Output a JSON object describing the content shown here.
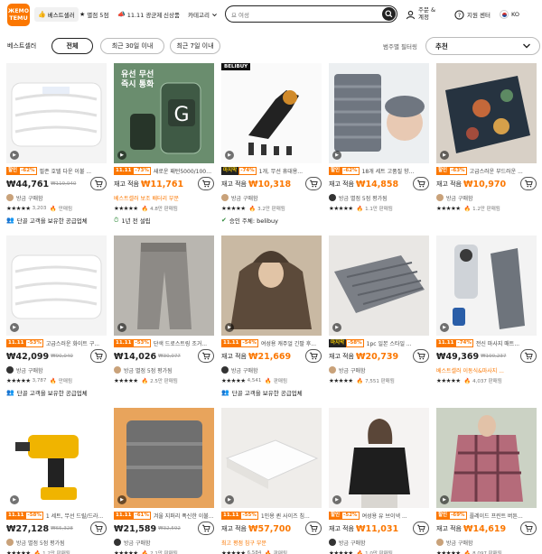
{
  "brand": {
    "logo_top": "ЖЕМО",
    "logo_bottom": "TEMU",
    "color": "#fb7701"
  },
  "nav": {
    "bestseller": "베스트셀러",
    "five_star": "별점 5점",
    "sale": "11.11 광군제",
    "new": "신상품",
    "category": "카테고리"
  },
  "search": {
    "value": "요 여성"
  },
  "header": {
    "orders": "주문 & 계정",
    "support": "지원 센터",
    "lang": "KO"
  },
  "filters": {
    "page_title": "베스트셀러",
    "chips": [
      "전체",
      "최근 30일 이내",
      "최근 7일 이내"
    ],
    "sort_label": "범주별 필터링",
    "sort_value": "추천"
  },
  "products": [
    {
      "tag1": "할인",
      "tag2": "-62%",
      "title": "필존 호텔 다운 이불 ...",
      "stock": "",
      "price": "₩44,761",
      "old": "₩119,940",
      "sold": "",
      "seller_icon": "user",
      "seller": "방금 구매함",
      "stars": "★★★★★",
      "rcount": "3,203",
      "hot": "만매됨",
      "extra": "단골 고객을 보유한 공급업체",
      "extra_icon": "👥"
    },
    {
      "tag1": "11.11",
      "tag2": "-73%",
      "title": "새로운 패턴5000/1000...",
      "stock": "재고 적음",
      "price": "₩11,761",
      "old": "",
      "sold": "",
      "seller_icon": "",
      "seller": "베스트셀러 보조 배터리 부문",
      "stars": "★★★★★",
      "rcount": "",
      "hot": "4.8만 판매됨",
      "extra": "1년 전 설립",
      "extra_icon": "⏱"
    },
    {
      "tag1": "마지막",
      "tag2": "-74%",
      "title": "1개, 무선 휴대용...",
      "stock": "재고 적음",
      "price": "₩10,318",
      "old": "",
      "sold": "",
      "seller_icon": "user",
      "seller": "방금 구매함",
      "stars": "★★★★★",
      "rcount": "",
      "hot": "3.2만 판매됨",
      "extra": "승인 주체: belibuy",
      "extra_icon": "✔"
    },
    {
      "tag1": "할인",
      "tag2": "-62%",
      "title": "18개 세트 고품질 향...",
      "stock": "재고 적음",
      "price": "₩14,858",
      "old": "",
      "sold": "",
      "seller_icon": "user",
      "seller": "방금 별점 5점 평가됨",
      "stars": "★★★★★",
      "rcount": "",
      "hot": "1.1만 판매됨",
      "extra": "",
      "extra_icon": ""
    },
    {
      "tag1": "할인",
      "tag2": "-63%",
      "title": "고급스러운 부드러운 ...",
      "stock": "재고 적음",
      "price": "₩10,970",
      "old": "",
      "sold": "",
      "seller_icon": "user",
      "seller": "방금 구매함",
      "stars": "★★★★★",
      "rcount": "",
      "hot": "1.2만 판매됨",
      "extra": "",
      "extra_icon": ""
    },
    {
      "tag1": "11.11",
      "tag2": "-53%",
      "title": "고급스러운 화이트 구...",
      "stock": "",
      "price": "₩42,099",
      "old": "₩90,040",
      "sold": "",
      "seller_icon": "user",
      "seller": "방금 구매함",
      "stars": "★★★★★",
      "rcount": "3,787",
      "hot": "만매됨",
      "extra": "단골 고객을 보유한 공급업체",
      "extra_icon": "👥"
    },
    {
      "tag1": "11.11",
      "tag2": "-53%",
      "title": "단색 드로스트링 조거...",
      "stock": "",
      "price": "₩14,026",
      "old": "₩30,077",
      "sold": "",
      "seller_icon": "user",
      "seller": "방금 별점 5점 평가됨",
      "stars": "★★★★★",
      "rcount": "",
      "hot": "2.5만 판매됨",
      "extra": "",
      "extra_icon": ""
    },
    {
      "tag1": "11.11",
      "tag2": "-54%",
      "title": "여성용 캐주얼 긴팔 후...",
      "stock": "재고 적음",
      "price": "₩21,669",
      "old": "",
      "sold": "",
      "seller_icon": "user",
      "seller": "방금 구매함",
      "stars": "★★★★★",
      "rcount": "4,541",
      "hot": "판매됨",
      "extra": "단골 고객을 보유한 공급업체",
      "extra_icon": "👥"
    },
    {
      "tag1": "마지막",
      "tag2": "-58%",
      "title": "1pc 일본 스타일 ...",
      "stock": "재고 적음",
      "price": "₩20,739",
      "old": "",
      "sold": "",
      "seller_icon": "user",
      "seller": "방금 구매함",
      "stars": "★★★★★",
      "rcount": "",
      "hot": "7,551 판매됨",
      "extra": "",
      "extra_icon": ""
    },
    {
      "tag1": "11.11",
      "tag2": "-74%",
      "title": "전신 마사지 매트...",
      "stock": "",
      "price": "₩49,369",
      "old": "₩190,237",
      "sold": "",
      "seller_icon": "",
      "seller": "베스트셀러 이동식&마사지 ...",
      "stars": "★★★★★",
      "rcount": "",
      "hot": "4,037 판매됨",
      "extra": "",
      "extra_icon": ""
    },
    {
      "tag1": "11.11",
      "tag2": "-58%",
      "title": "1 세트, 무선 드릴/드라...",
      "stock": "",
      "price": "₩27,128",
      "old": "₩65,328",
      "sold": "",
      "seller_icon": "user",
      "seller": "방금 별점 5점 평가됨",
      "stars": "★★★★★",
      "rcount": "",
      "hot": "1.2만 판매됨",
      "extra": "",
      "extra_icon": ""
    },
    {
      "tag1": "11.11",
      "tag2": "-61%",
      "title": "겨울 지퍼리 폭신한 이불...",
      "stock": "",
      "price": "₩21,589",
      "old": "₩32,592",
      "sold": "",
      "seller_icon": "user",
      "seller": "방금 구매함",
      "stars": "★★★★★",
      "rcount": "",
      "hot": "2.1만 판매됨",
      "extra": "",
      "extra_icon": ""
    },
    {
      "tag1": "11.11",
      "tag2": "-55%",
      "title": "1인용 퀸 사이즈 침...",
      "stock": "재고 적음",
      "price": "₩57,700",
      "old": "",
      "sold": "",
      "seller_icon": "",
      "seller": "최고 평점 침구 부문",
      "stars": "★★★★★",
      "rcount": "6,584",
      "hot": "판매됨",
      "extra": "",
      "extra_icon": ""
    },
    {
      "tag1": "할인",
      "tag2": "-52%",
      "title": "여성용 유 브이넥 ...",
      "stock": "재고 적음",
      "price": "₩11,031",
      "old": "",
      "sold": "",
      "seller_icon": "user",
      "seller": "방금 구매함",
      "stars": "★★★★★",
      "rcount": "",
      "hot": "1.0만 판매됨",
      "extra": "",
      "extra_icon": ""
    },
    {
      "tag1": "할인",
      "tag2": "-69%",
      "title": "플레이드 프린트 버튼...",
      "stock": "재고 적음",
      "price": "₩14,619",
      "old": "",
      "sold": "",
      "seller_icon": "user",
      "seller": "방금 구매함",
      "stars": "★★★★★",
      "rcount": "",
      "hot": "8,097 판매됨",
      "extra": "",
      "extra_icon": ""
    }
  ],
  "image_labels": {
    "p2_promo": "유선 무선\n즉시 통화",
    "p3_brand": "BELIBUY"
  }
}
